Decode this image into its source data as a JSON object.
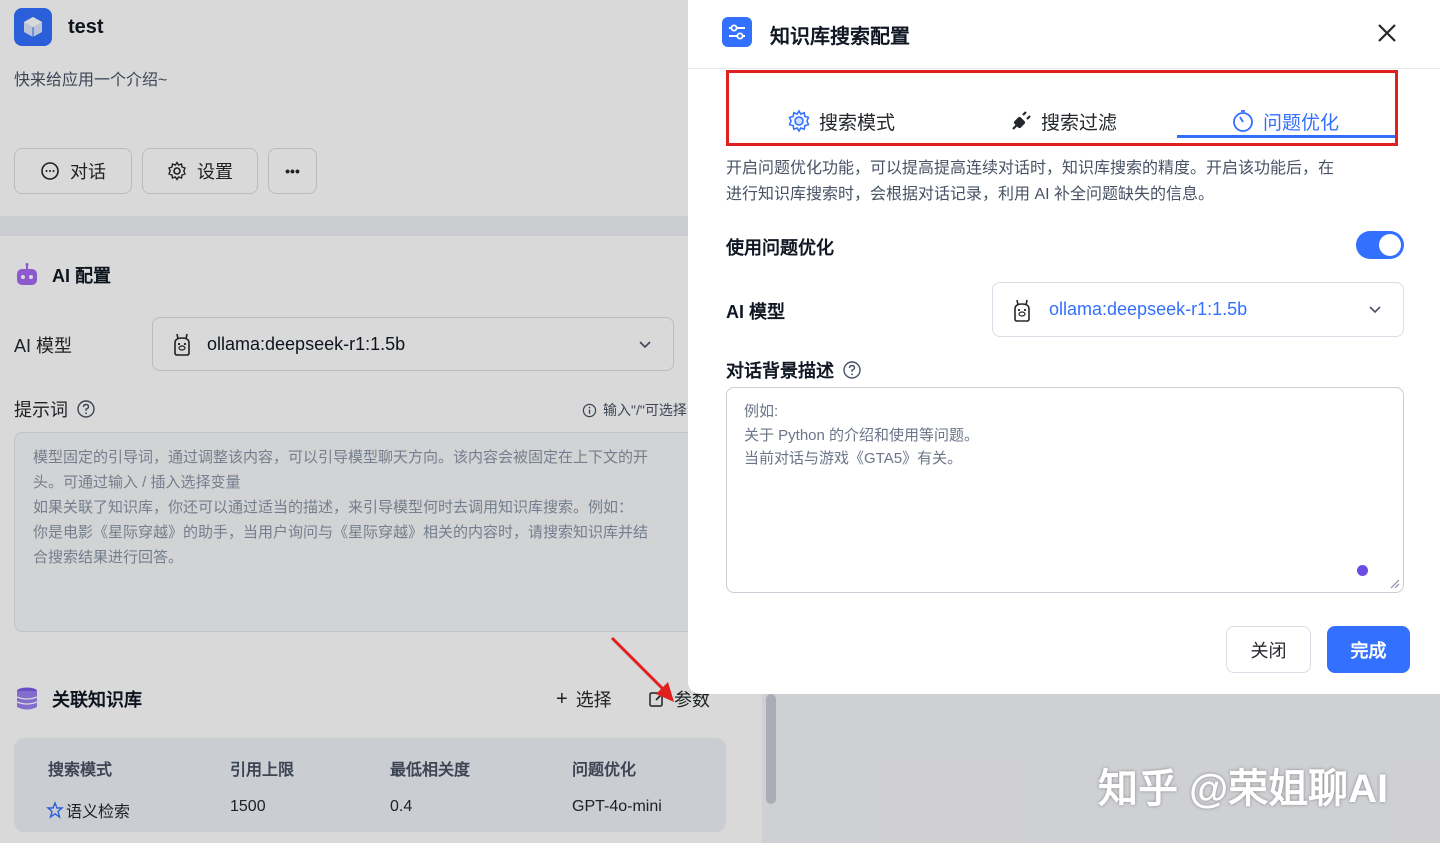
{
  "app": {
    "name": "test",
    "intro": "快来给应用一个介绍~",
    "buttons": {
      "chat": "对话",
      "settings": "设置",
      "more": "•••"
    }
  },
  "ai_config": {
    "title": "AI 配置",
    "model_label": "AI 模型",
    "model_value": "ollama:deepseek-r1:1.5b",
    "prompt_label": "提示词",
    "prompt_hint": "输入\"/\"可选择",
    "prompt_lines": [
      "模型固定的引导词，通过调整该内容，可以引导模型聊天方向。该内容会被固定在上下文的开",
      "头。可通过输入 / 插入选择变量",
      "如果关联了知识库，你还可以通过适当的描述，来引导模型何时去调用知识库搜索。例如：",
      "你是电影《星际穿越》的助手，当用户询问与《星际穿越》相关的内容时，请搜索知识库并结",
      "合搜索结果进行回答。"
    ]
  },
  "knowledge": {
    "title": "关联知识库",
    "select_label": "选择",
    "params_label": "参数",
    "headers": [
      "搜索模式",
      "引用上限",
      "最低相关度",
      "问题优化"
    ],
    "row": [
      "语义检索",
      "1500",
      "0.4",
      "GPT-4o-mini"
    ]
  },
  "modal": {
    "title": "知识库搜索配置",
    "tabs": [
      "搜索模式",
      "搜索过滤",
      "问题优化"
    ],
    "active_tab": 2,
    "description_lines": [
      "开启问题优化功能，可以提高提高连续对话时，知识库搜索的精度。开启该功能后，在",
      "进行知识库搜索时，会根据对话记录，利用 AI 补全问题缺失的信息。"
    ],
    "use_optimize_label": "使用问题优化",
    "use_optimize_enabled": true,
    "model_label": "AI 模型",
    "model_value": "ollama:deepseek-r1:1.5b",
    "background_label": "对话背景描述",
    "background_placeholder_lines": [
      "例如:",
      "关于 Python 的介绍和使用等问题。",
      "当前对话与游戏《GTA5》有关。"
    ],
    "close_button": "关闭",
    "done_button": "完成"
  },
  "watermark": "知乎 @荣姐聊AI",
  "colors": {
    "primary": "#3370ff",
    "highlight_box": "#e0201e",
    "arrow": "#e0201e"
  }
}
